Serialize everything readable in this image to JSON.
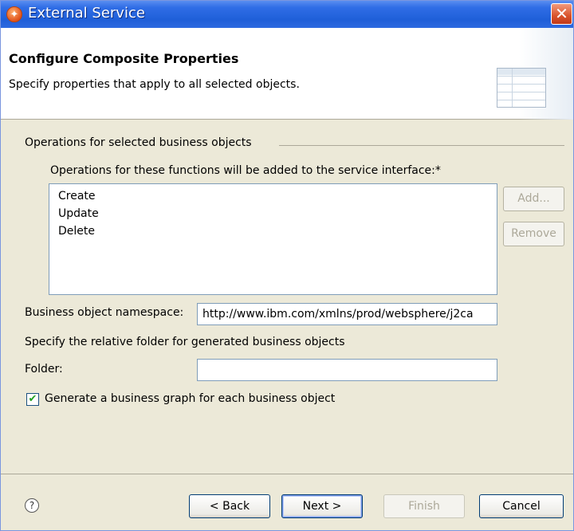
{
  "window": {
    "title": "External Service",
    "close_label": "✕",
    "app_icon_glyph": "✦"
  },
  "banner": {
    "title": "Configure Composite Properties",
    "description": "Specify properties that apply to all selected objects."
  },
  "operations": {
    "group_label": "Operations for selected business objects",
    "list_label": "Operations for these functions will be added to the service interface:*",
    "items": [
      "Create",
      "Update",
      "Delete"
    ],
    "add_label": "Add...",
    "remove_label": "Remove"
  },
  "namespace": {
    "label": "Business object namespace:",
    "value": "http://www.ibm.com/xmlns/prod/websphere/j2ca"
  },
  "folder": {
    "hint": "Specify the relative folder for generated business objects",
    "label": "Folder:",
    "value": ""
  },
  "business_graph": {
    "label": "Generate a business graph for each business object",
    "checked": true,
    "check_glyph": "✔"
  },
  "footer": {
    "help_glyph": "?",
    "back_label": "< Back",
    "next_label": "Next >",
    "finish_label": "Finish",
    "cancel_label": "Cancel"
  }
}
